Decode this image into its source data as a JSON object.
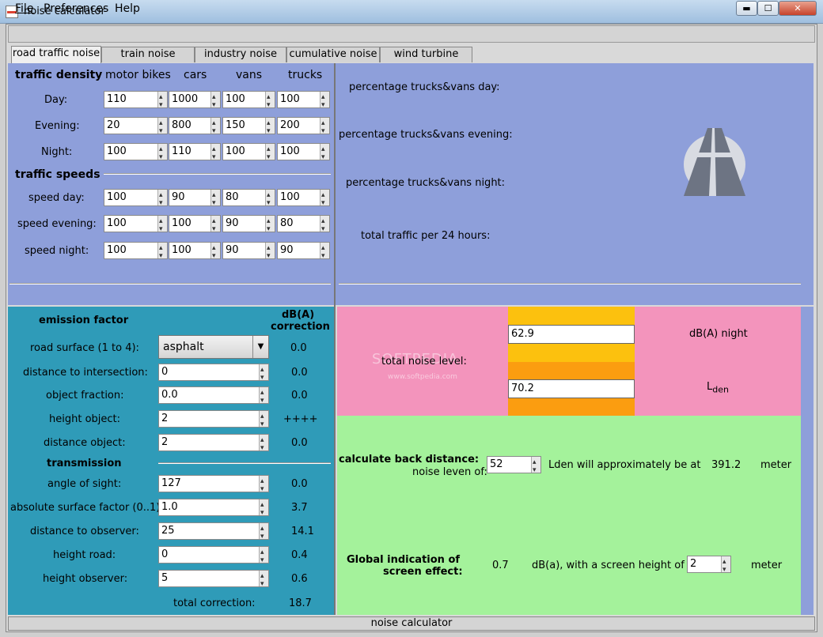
{
  "window": {
    "title": "noise calculator",
    "min": "▬",
    "max": "☐",
    "close": "✕"
  },
  "menu": [
    {
      "label": "File"
    },
    {
      "label": "Preferences"
    },
    {
      "label": "Help"
    }
  ],
  "tabs": [
    {
      "label": "road traffic noise",
      "active": true
    },
    {
      "label": "train noise"
    },
    {
      "label": "industry noise"
    },
    {
      "label": "cumulative noise"
    },
    {
      "label": "wind turbine"
    }
  ],
  "density": {
    "heading": "traffic density",
    "columns": [
      "motor bikes",
      "cars",
      "vans",
      "trucks"
    ],
    "rows": [
      {
        "label": "Day:",
        "values": [
          "110",
          "1000",
          "100",
          "100"
        ]
      },
      {
        "label": "Evening:",
        "values": [
          "20",
          "800",
          "150",
          "200"
        ]
      },
      {
        "label": "Night:",
        "values": [
          "100",
          "110",
          "100",
          "100"
        ]
      }
    ]
  },
  "speeds": {
    "heading": "traffic speeds",
    "rows": [
      {
        "label": "speed day:",
        "values": [
          "100",
          "90",
          "80",
          "100"
        ]
      },
      {
        "label": "speed evening:",
        "values": [
          "100",
          "100",
          "90",
          "80"
        ]
      },
      {
        "label": "speed night:",
        "values": [
          "100",
          "100",
          "90",
          "90"
        ]
      }
    ]
  },
  "stats": [
    {
      "label": "percentage trucks&vans day:"
    },
    {
      "label": "percentage trucks&vans evening:"
    },
    {
      "label": "percentage trucks&vans night:"
    },
    {
      "label": "total traffic per 24 hours:"
    }
  ],
  "road_icon": "road-sign-icon",
  "emission": {
    "heading": "emission factor",
    "corr_heading_1": "dB(A)",
    "corr_heading_2": "correction",
    "road_surface": {
      "label": "road surface (1 to 4):",
      "value": "asphalt",
      "correction": "0.0"
    },
    "rows": [
      {
        "label": "distance to intersection:",
        "value": "0",
        "correction": "0.0"
      },
      {
        "label": "object fraction:",
        "value": "0.0",
        "correction": "0.0"
      },
      {
        "label": "height object:",
        "value": "2",
        "correction": "++++"
      },
      {
        "label": "distance object:",
        "value": "2",
        "correction": "0.0"
      }
    ]
  },
  "transmission": {
    "heading": "transmission",
    "rows": [
      {
        "label": "angle of sight:",
        "value": "127",
        "correction": "0.0"
      },
      {
        "label": "absolute surface factor (0..1)",
        "value": "1.0",
        "correction": "3.7"
      },
      {
        "label": "distance to observer:",
        "value": "25",
        "correction": "14.1"
      },
      {
        "label": "height road:",
        "value": "0",
        "correction": "0.4"
      },
      {
        "label": "height observer:",
        "value": "5",
        "correction": "0.6"
      }
    ],
    "total_label": "total correction:",
    "total_value": "18.7"
  },
  "noise": {
    "label": "total noise level:",
    "night_value": "62.9",
    "night_unit": "dB(A) night",
    "lden_value": "70.2",
    "lden_L": "L",
    "lden_sub": "den",
    "watermark": "SOFTPEDIA",
    "watermark_sub": "www.softpedia.com"
  },
  "back_distance": {
    "label": "calculate back distance:",
    "sublabel": "noise leven of:",
    "value": "52",
    "text": "Lden will approximately be at",
    "result": "391.2",
    "unit": "meter"
  },
  "screen": {
    "label1": "Global indication of",
    "label2": "screen effect:",
    "value": "0.7",
    "text": "dB(a), with a screen height of",
    "height": "2",
    "unit": "meter"
  },
  "status": "noise calculator"
}
